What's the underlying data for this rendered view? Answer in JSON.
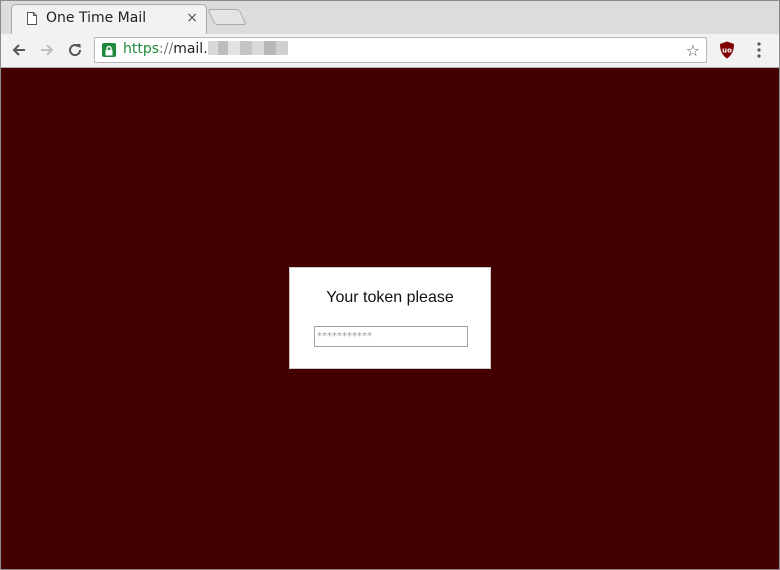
{
  "browser": {
    "tab_title": "One Time Mail",
    "tab_close": "×",
    "url_scheme": "https",
    "url_separator": "://",
    "url_host_visible": "mail.",
    "star": "☆"
  },
  "icons": {
    "tab_favicon": "page-icon",
    "back": "arrow-left-icon",
    "forward": "arrow-right-icon",
    "reload": "reload-icon",
    "lock": "lock-icon",
    "bookmark": "star-icon",
    "extension": "ublock-icon",
    "menu": "kebab-menu-icon"
  },
  "page": {
    "background_color": "#420000",
    "dialog_title": "Your token please",
    "token_placeholder": "***********"
  }
}
